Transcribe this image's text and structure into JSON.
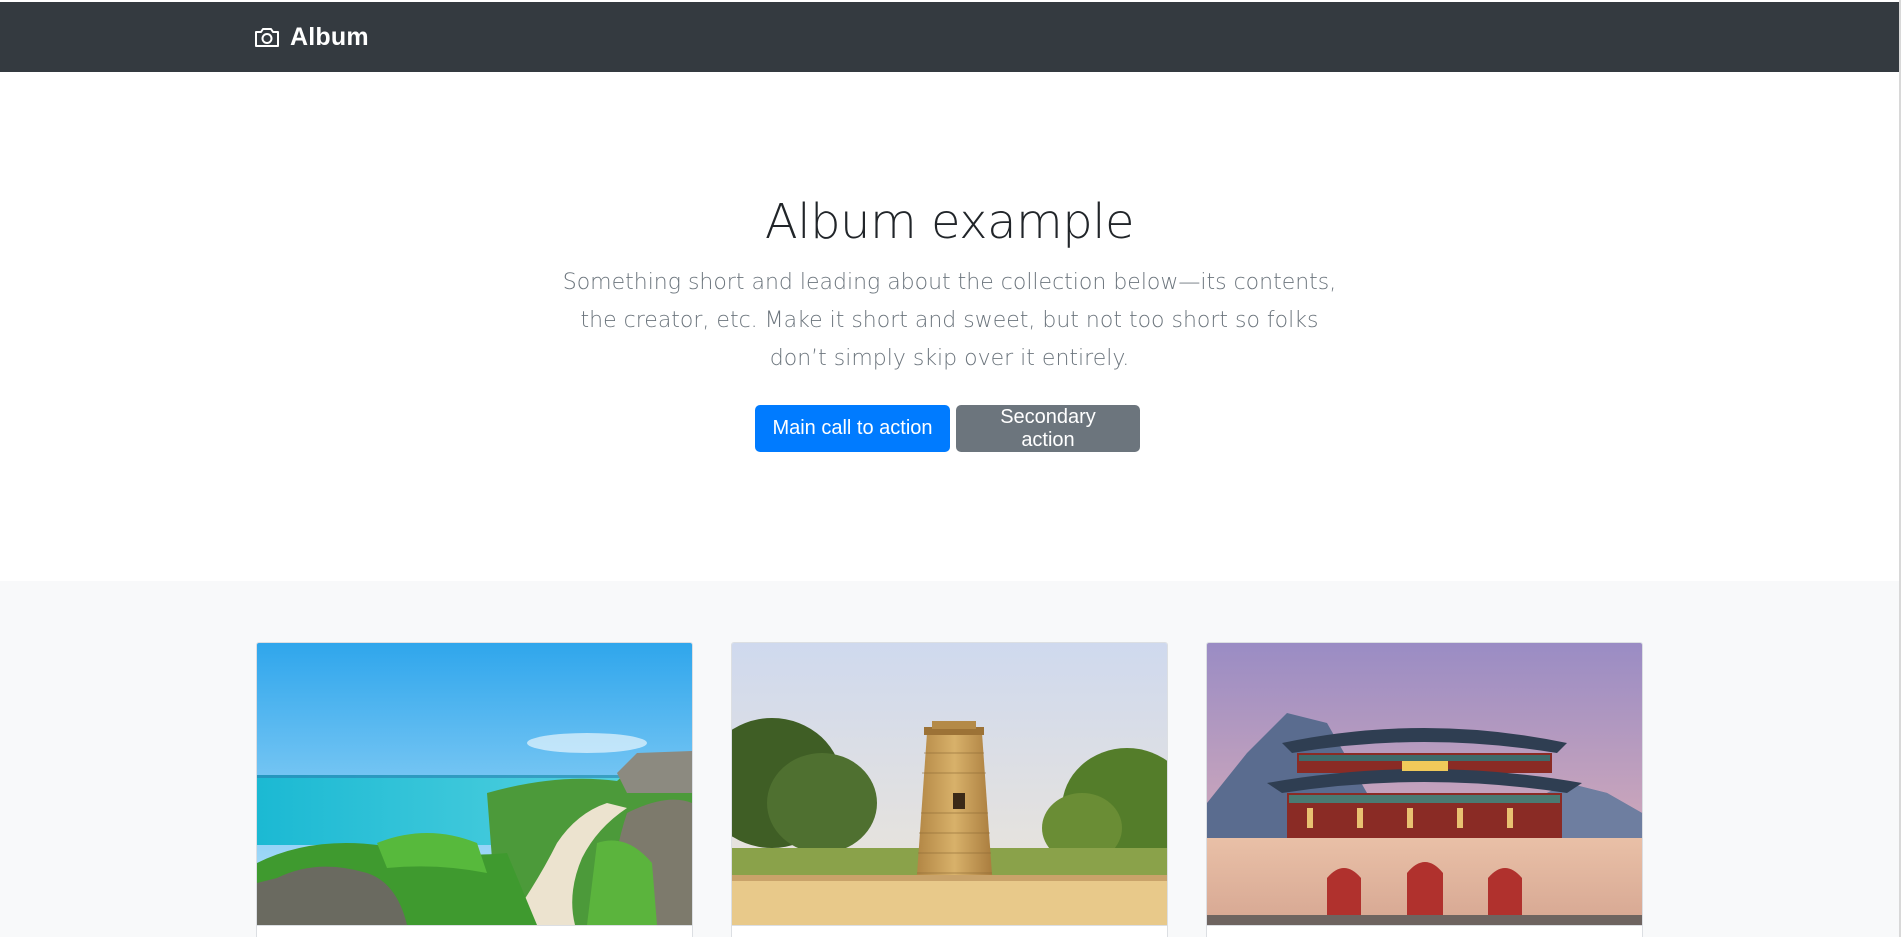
{
  "navbar": {
    "brand_icon": "camera-icon",
    "brand_text": "Album",
    "background": "#343a40"
  },
  "hero": {
    "title": "Album example",
    "lead": "Something short and leading about the collection below—its contents, the creator, etc. Make it short and sweet, but not too short so folks don’t simply skip over it entirely.",
    "primary_button": "Main call to action",
    "secondary_button": "Secondary action",
    "colors": {
      "primary": "#007bff",
      "secondary": "#6c757d",
      "lead_text": "#6c757d"
    }
  },
  "album": {
    "background": "#f8f9fa",
    "cards": [
      {
        "image": "coastal-path-photo"
      },
      {
        "image": "stone-observatory-tower-photo"
      },
      {
        "image": "palace-gate-photo"
      }
    ]
  }
}
